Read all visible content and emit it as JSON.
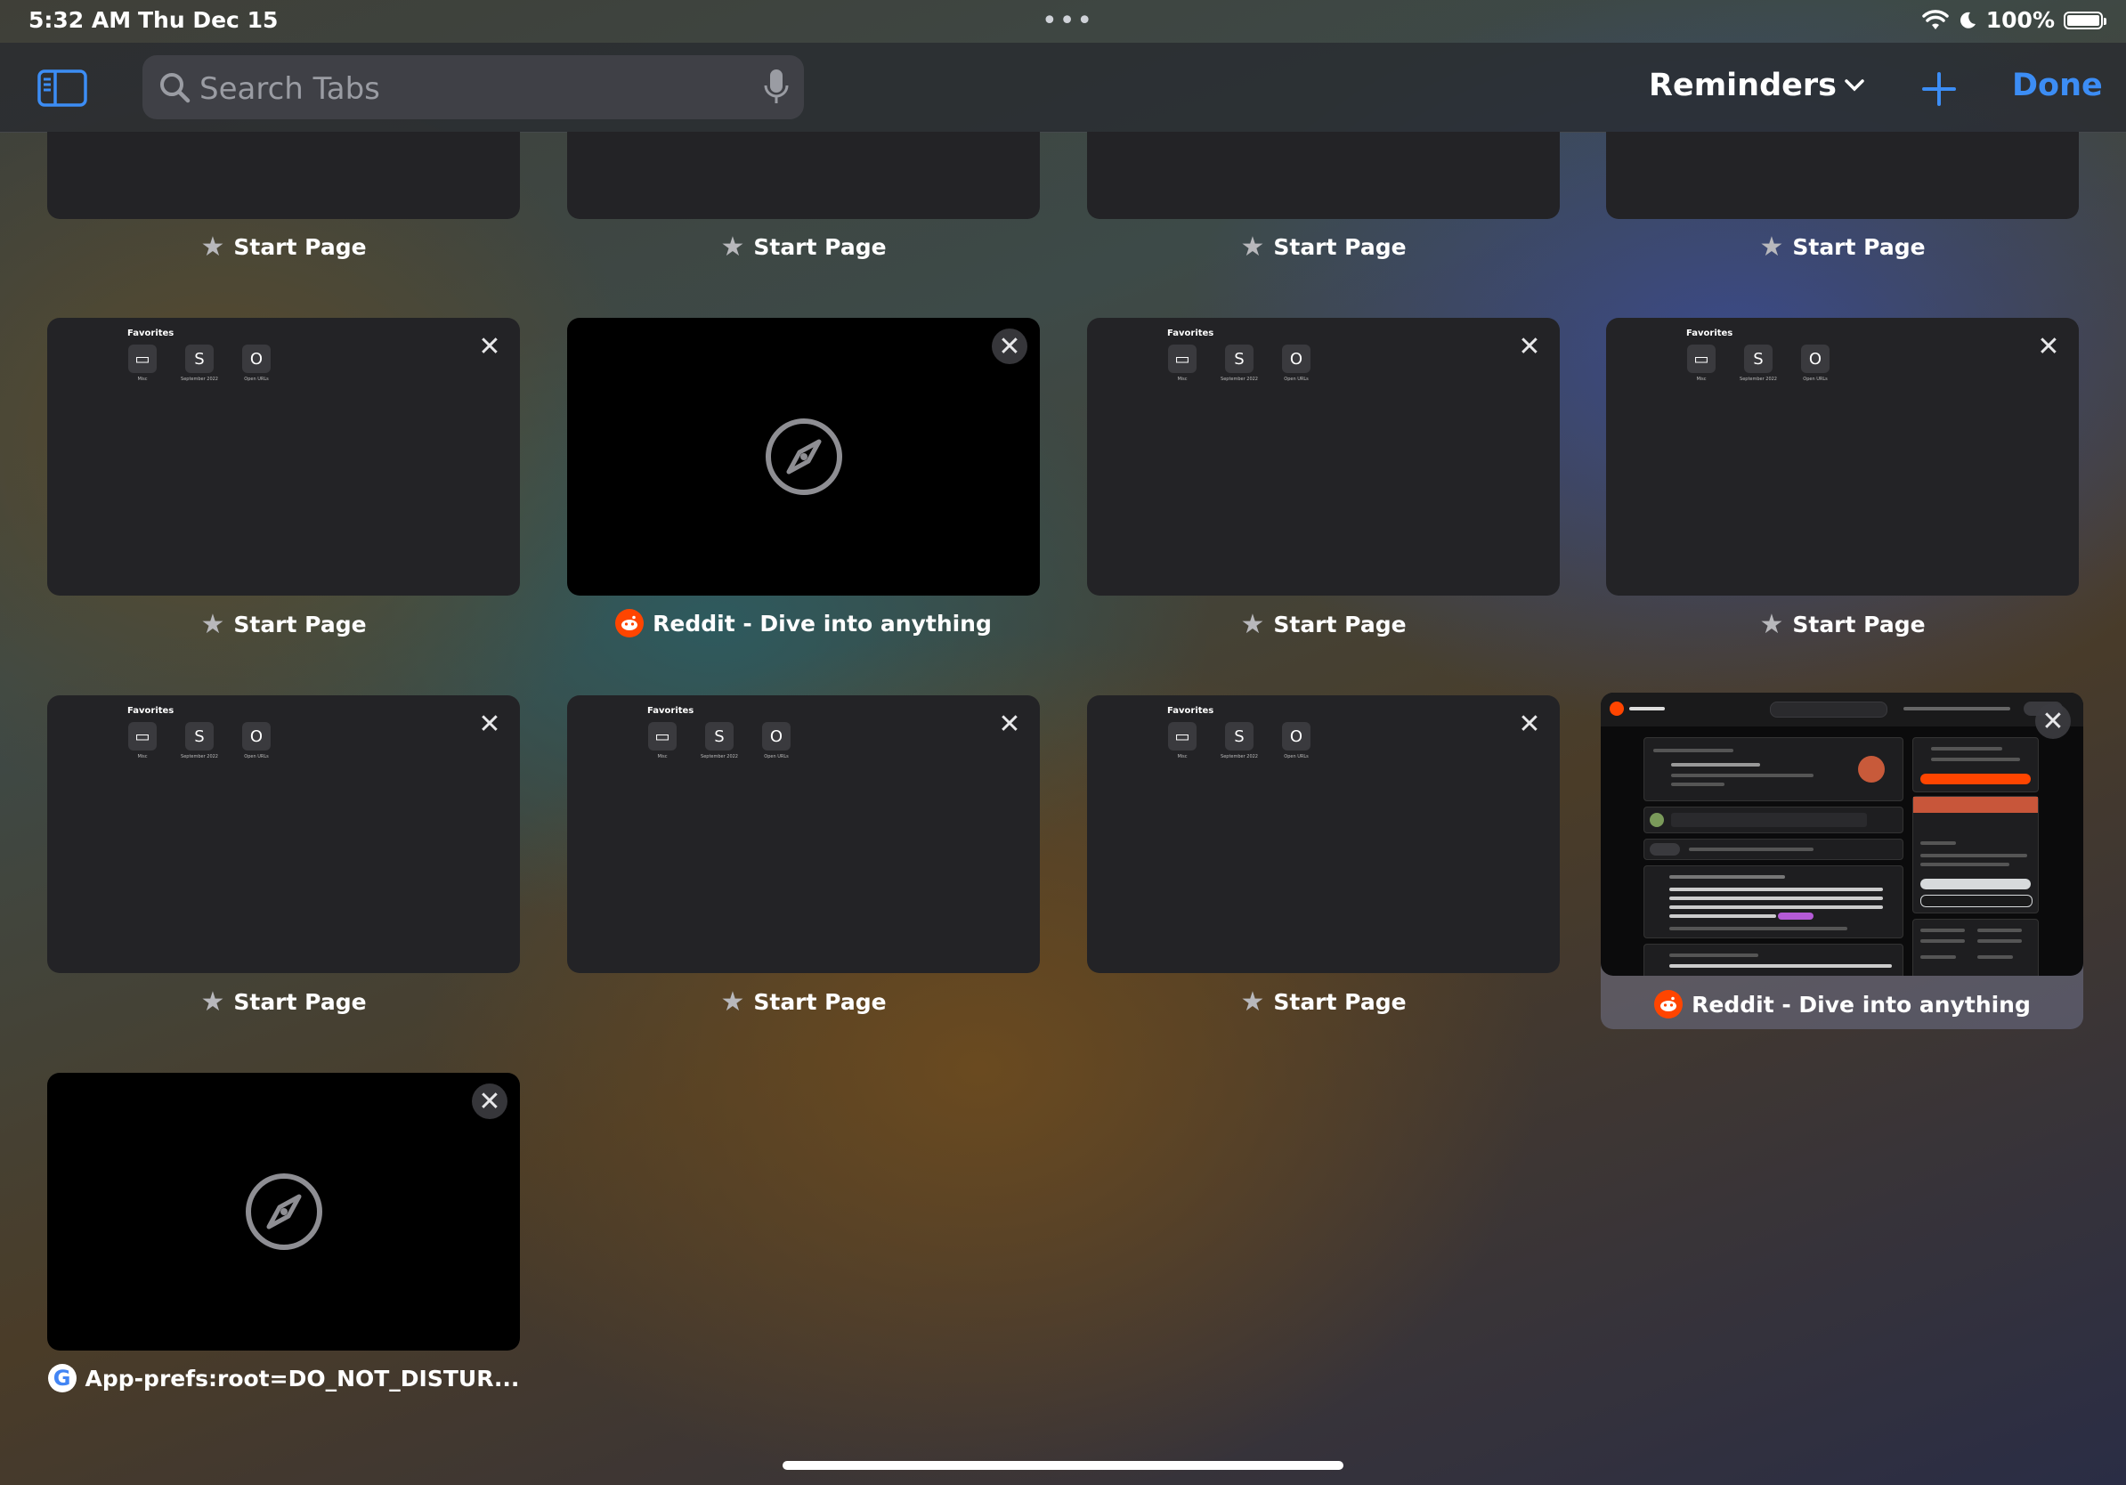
{
  "status": {
    "time": "5:32 AM",
    "date": "Thu Dec 15",
    "battery": "100%"
  },
  "toolbar": {
    "search_placeholder": "Search Tabs",
    "group_name": "Reminders",
    "done_label": "Done"
  },
  "favorites": {
    "title": "Favorites",
    "items": [
      {
        "letter": "",
        "label": "Misc"
      },
      {
        "letter": "S",
        "label": "September 2022"
      },
      {
        "letter": "O",
        "label": "Open URLs"
      }
    ]
  },
  "tabs": [
    {
      "title": "Start Page",
      "icon": "star-icon"
    },
    {
      "title": "Start Page",
      "icon": "star-icon"
    },
    {
      "title": "Start Page",
      "icon": "star-icon"
    },
    {
      "title": "Start Page",
      "icon": "star-icon"
    },
    {
      "title": "Start Page",
      "icon": "star-icon"
    },
    {
      "title": "Reddit - Dive into anything",
      "icon": "reddit-icon"
    },
    {
      "title": "Start Page",
      "icon": "star-icon"
    },
    {
      "title": "Start Page",
      "icon": "star-icon"
    },
    {
      "title": "Start Page",
      "icon": "star-icon"
    },
    {
      "title": "Start Page",
      "icon": "star-icon"
    },
    {
      "title": "Start Page",
      "icon": "star-icon"
    },
    {
      "title": "Reddit - Dive into anything",
      "icon": "reddit-icon"
    },
    {
      "title": "App-prefs:root=DO_NOT_DISTUR...",
      "icon": "google-icon"
    }
  ],
  "accent_color": "#3c8df5"
}
